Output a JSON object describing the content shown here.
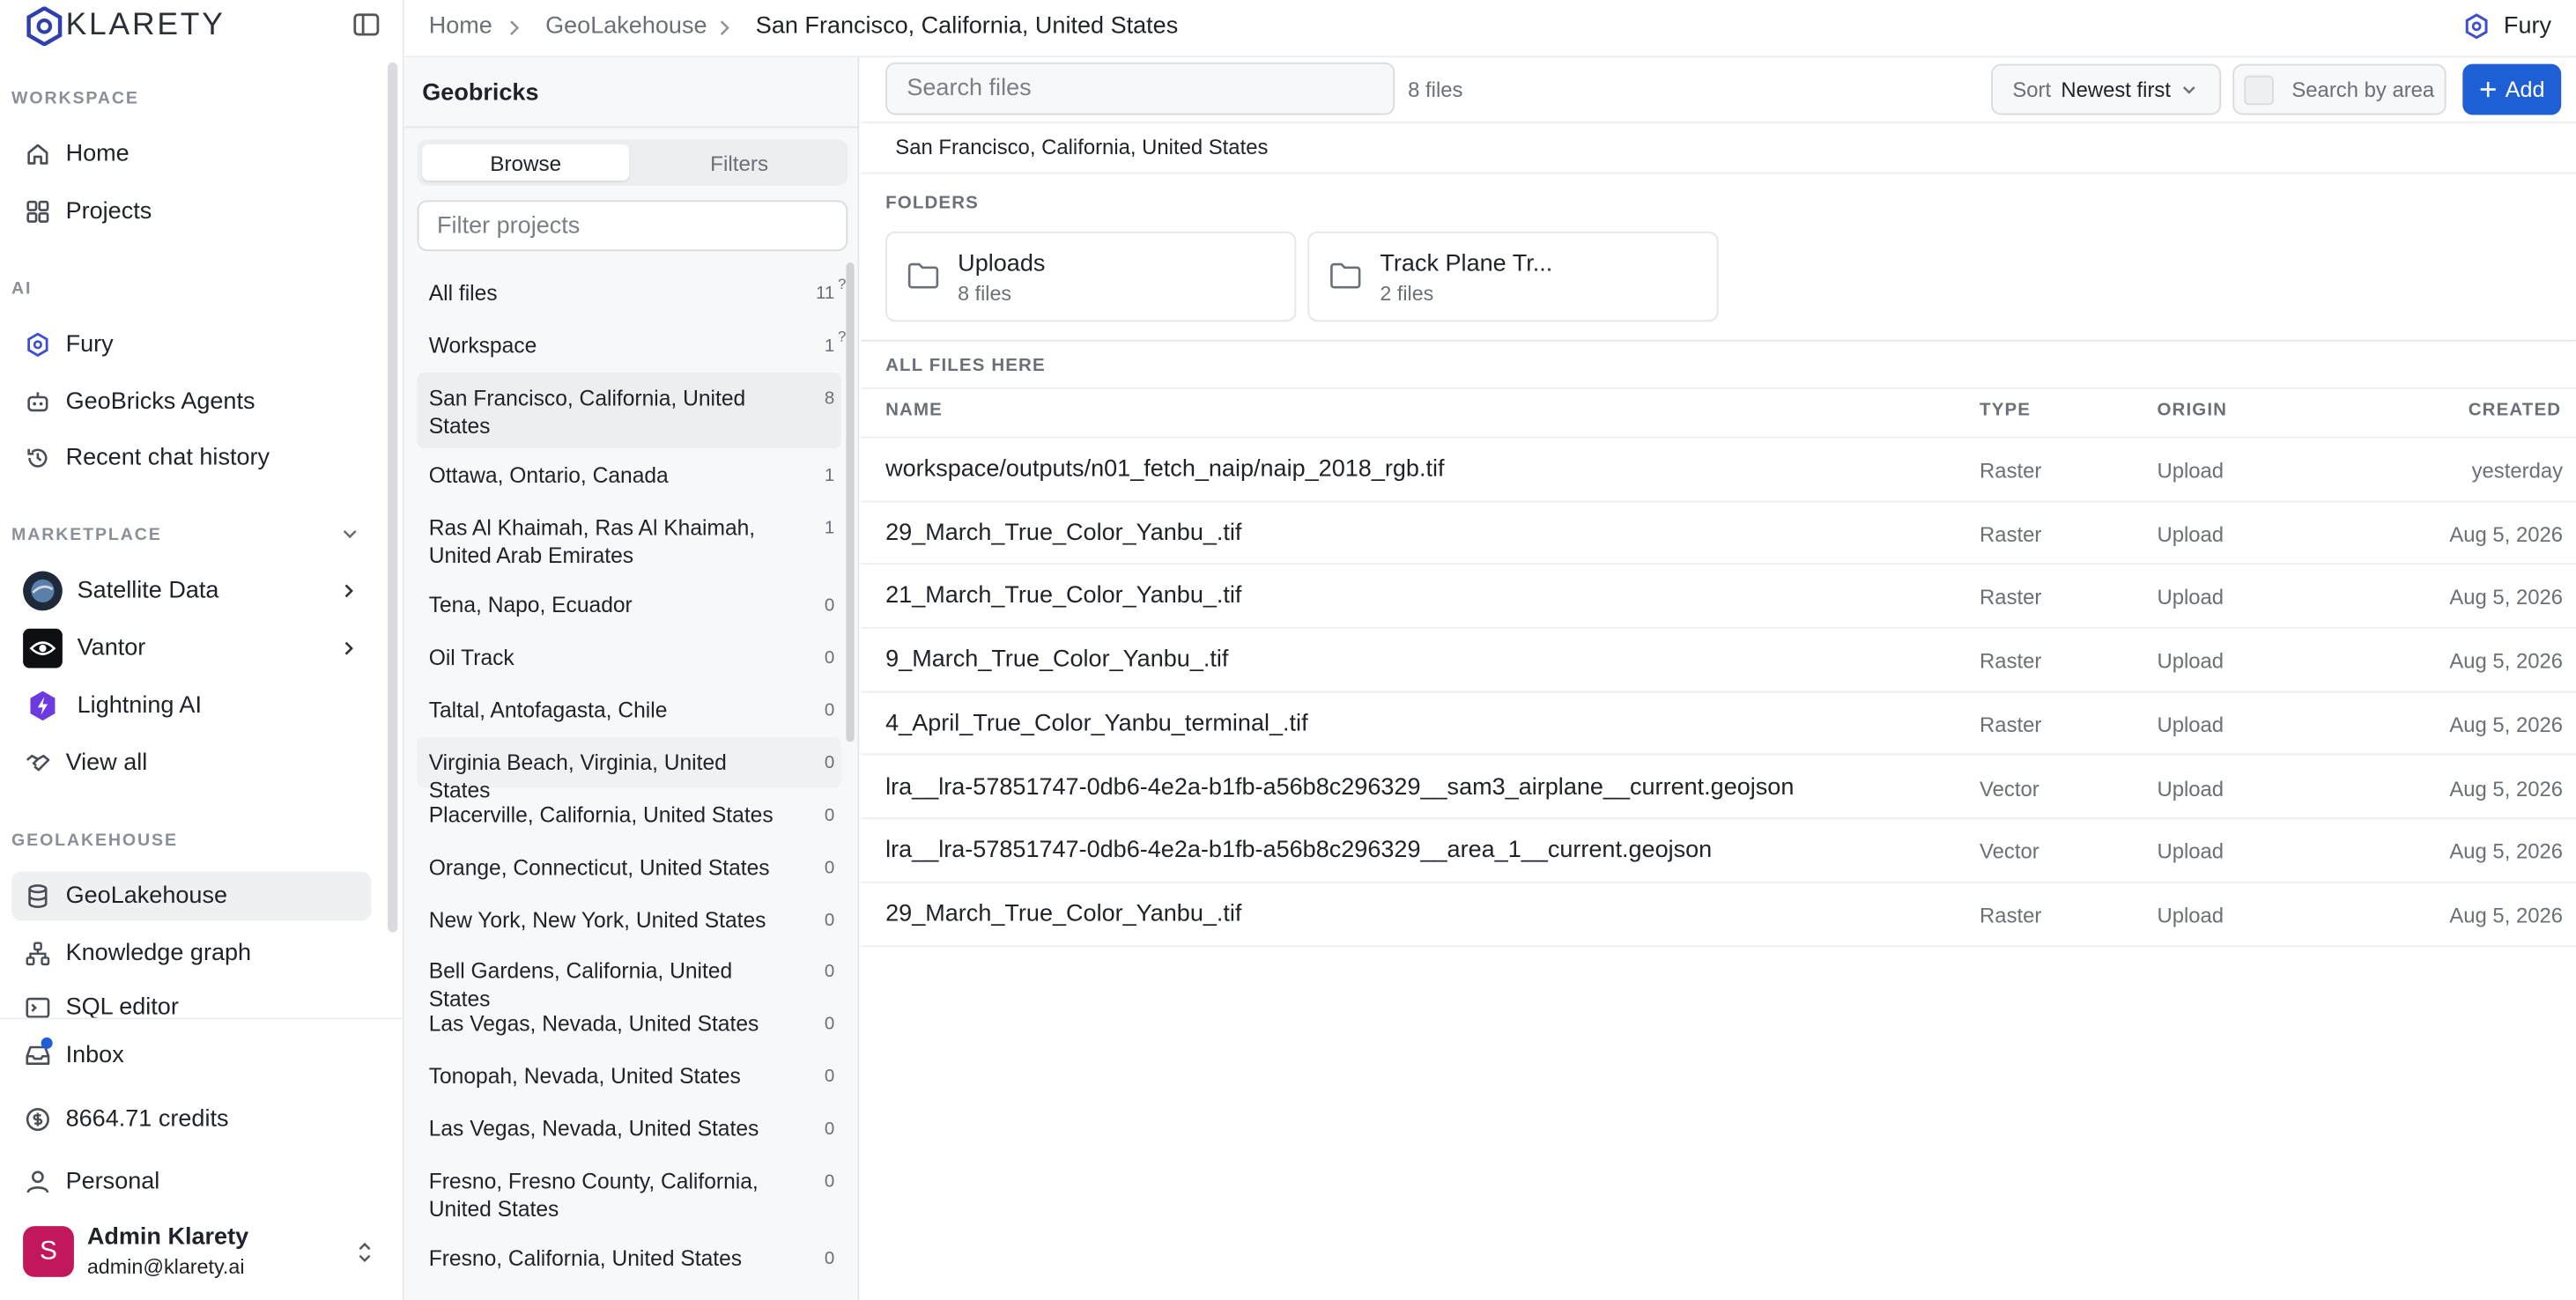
{
  "brand": {
    "name": "KLARETY"
  },
  "sidebar": {
    "workspace_label": "WORKSPACE",
    "workspace_items": [
      {
        "label": "Home"
      },
      {
        "label": "Projects"
      }
    ],
    "ai_label": "AI",
    "ai_items": [
      {
        "label": "Fury"
      },
      {
        "label": "GeoBricks Agents"
      },
      {
        "label": "Recent chat history"
      }
    ],
    "marketplace_label": "MARKETPLACE",
    "marketplace_items": [
      {
        "label": "Satellite Data"
      },
      {
        "label": "Vantor"
      },
      {
        "label": "Lightning AI"
      },
      {
        "label": "View all"
      }
    ],
    "geolakehouse_label": "GEOLAKEHOUSE",
    "geolakehouse_items": [
      {
        "label": "GeoLakehouse"
      },
      {
        "label": "Knowledge graph"
      },
      {
        "label": "SQL editor"
      }
    ],
    "bottom_items": [
      {
        "label": "Inbox"
      },
      {
        "label": "8664.71 credits"
      },
      {
        "label": "Personal"
      }
    ],
    "user": {
      "initial": "S",
      "name": "Admin Klarety",
      "email": "admin@klarety.ai"
    }
  },
  "topbar": {
    "breadcrumbs": [
      "Home",
      "GeoLakehouse",
      "San Francisco, California, United States"
    ],
    "assistant_label": "Fury"
  },
  "middle": {
    "title": "Geobricks",
    "tabs": [
      "Browse",
      "Filters"
    ],
    "filter_placeholder": "Filter projects",
    "projects": [
      {
        "label": "All files",
        "count": "11",
        "q": "?"
      },
      {
        "label": "Workspace",
        "count": "1",
        "q": "?"
      },
      {
        "label": "San Francisco, California, United States",
        "count": "8"
      },
      {
        "label": "Ottawa, Ontario, Canada",
        "count": "1"
      },
      {
        "label": "Ras Al Khaimah, Ras Al Khaimah, United Arab Emirates",
        "count": "1"
      },
      {
        "label": "Tena, Napo, Ecuador",
        "count": "0"
      },
      {
        "label": "Oil Track",
        "count": "0"
      },
      {
        "label": "Taltal, Antofagasta, Chile",
        "count": "0"
      },
      {
        "label": "Virginia Beach, Virginia, United States",
        "count": "0"
      },
      {
        "label": "Placerville, California, United States",
        "count": "0"
      },
      {
        "label": "Orange, Connecticut, United States",
        "count": "0"
      },
      {
        "label": "New York, New York, United States",
        "count": "0"
      },
      {
        "label": "Bell Gardens, California, United States",
        "count": "0"
      },
      {
        "label": "Las Vegas, Nevada, United States",
        "count": "0"
      },
      {
        "label": "Tonopah, Nevada, United States",
        "count": "0"
      },
      {
        "label": "Las Vegas, Nevada, United States",
        "count": "0"
      },
      {
        "label": "Fresno, Fresno County, California, United States",
        "count": "0"
      },
      {
        "label": "Fresno, California, United States",
        "count": "0"
      }
    ]
  },
  "main": {
    "search_placeholder": "Search files",
    "file_count": "8 files",
    "sort_label": "Sort",
    "sort_value": "Newest first",
    "area_label": "Search by area",
    "add_label": "Add",
    "location": "San Francisco, California, United States",
    "folders_label": "FOLDERS",
    "folders": [
      {
        "name": "Uploads",
        "count": "8 files"
      },
      {
        "name": "Track Plane Tr...",
        "count": "2 files"
      }
    ],
    "all_files_label": "ALL FILES HERE",
    "columns": {
      "name": "NAME",
      "type": "TYPE",
      "origin": "ORIGIN",
      "created": "CREATED"
    },
    "files": [
      {
        "name": "workspace/outputs/n01_fetch_naip/naip_2018_rgb.tif",
        "type": "Raster",
        "origin": "Upload",
        "created": "yesterday"
      },
      {
        "name": "29_March_True_Color_Yanbu_.tif",
        "type": "Raster",
        "origin": "Upload",
        "created": "Aug 5, 2026"
      },
      {
        "name": "21_March_True_Color_Yanbu_.tif",
        "type": "Raster",
        "origin": "Upload",
        "created": "Aug 5, 2026"
      },
      {
        "name": "9_March_True_Color_Yanbu_.tif",
        "type": "Raster",
        "origin": "Upload",
        "created": "Aug 5, 2026"
      },
      {
        "name": "4_April_True_Color_Yanbu_terminal_.tif",
        "type": "Raster",
        "origin": "Upload",
        "created": "Aug 5, 2026"
      },
      {
        "name": "lra__lra-57851747-0db6-4e2a-b1fb-a56b8c296329__sam3_airplane__current.geojson",
        "type": "Vector",
        "origin": "Upload",
        "created": "Aug 5, 2026"
      },
      {
        "name": "lra__lra-57851747-0db6-4e2a-b1fb-a56b8c296329__area_1__current.geojson",
        "type": "Vector",
        "origin": "Upload",
        "created": "Aug 5, 2026"
      },
      {
        "name": "29_March_True_Color_Yanbu_.tif",
        "type": "Raster",
        "origin": "Upload",
        "created": "Aug 5, 2026"
      }
    ]
  },
  "colors": {
    "accent": "#1f5fd6",
    "avatar": "#c2185b",
    "notification_dot": "#1f5fd6"
  }
}
